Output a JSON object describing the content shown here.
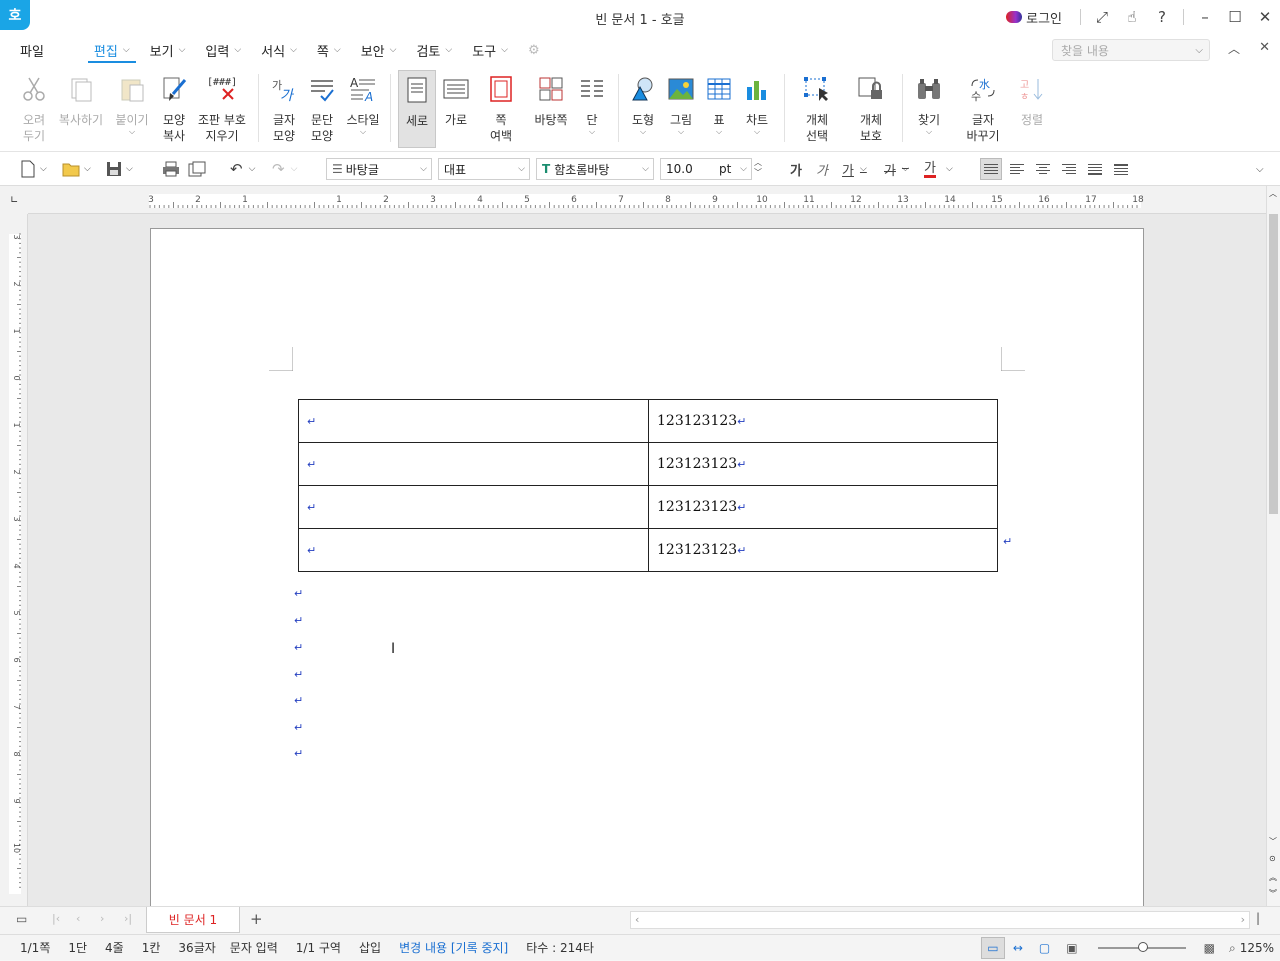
{
  "window": {
    "title": "빈 문서 1 - 호글",
    "app_logo": "호",
    "login": "로그인"
  },
  "menus": [
    {
      "label": "파일"
    },
    {
      "label": "편집",
      "active": true
    },
    {
      "label": "보기"
    },
    {
      "label": "입력"
    },
    {
      "label": "서식"
    },
    {
      "label": "쪽"
    },
    {
      "label": "보안"
    },
    {
      "label": "검토"
    },
    {
      "label": "도구"
    }
  ],
  "search": {
    "placeholder": "찾을 내용"
  },
  "ribbon": {
    "cut": [
      "오려",
      "두기"
    ],
    "copy": "복사하기",
    "paste": "붙이기",
    "format_copy": [
      "모양",
      "복사"
    ],
    "clear_mark": [
      "조판 부호",
      "지우기"
    ],
    "char_shape": [
      "글자",
      "모양"
    ],
    "para_shape": [
      "문단",
      "모양"
    ],
    "style": "스타일",
    "portrait": "세로",
    "landscape": "가로",
    "margin": [
      "쪽",
      "여백"
    ],
    "bg_page": "바탕쪽",
    "column": "단",
    "shape": "도형",
    "picture": "그림",
    "table": "표",
    "chart": "차트",
    "obj_select": [
      "개체",
      "선택"
    ],
    "obj_protect": [
      "개체",
      "보호"
    ],
    "find": "찾기",
    "replace": [
      "글자",
      "바꾸기"
    ],
    "sort": "정렬"
  },
  "format": {
    "style": "바탕글",
    "lang": "대표",
    "font": "함초롬바탕",
    "size": "10.0",
    "unit": "pt"
  },
  "ruler_h": [
    "3",
    "2",
    "1",
    "",
    "1",
    "2",
    "3",
    "4",
    "5",
    "6",
    "7",
    "8",
    "9",
    "10",
    "11",
    "12",
    "13",
    "14",
    "15",
    "16",
    "17",
    "18"
  ],
  "ruler_v": [
    "3",
    "2",
    "1",
    "0",
    "1",
    "2",
    "3",
    "4",
    "5",
    "6",
    "7",
    "8",
    "9",
    "10"
  ],
  "table": {
    "rows": [
      {
        "a": "",
        "b": "123123123"
      },
      {
        "a": "",
        "b": "123123123"
      },
      {
        "a": "",
        "b": "123123123"
      },
      {
        "a": "",
        "b": "123123123"
      }
    ]
  },
  "return_mark": "↵",
  "doc_tab": "빈 문서 1",
  "status": {
    "page": "1/1쪽",
    "column": "1단",
    "line": "4줄",
    "cell": "1칸",
    "chars": "36글자",
    "mode": "문자 입력",
    "section": "1/1 구역",
    "insert": "삽입",
    "track": "변경 내용 [기록 중지]",
    "keystrokes": "타수 : 214타",
    "zoom": "125%"
  }
}
